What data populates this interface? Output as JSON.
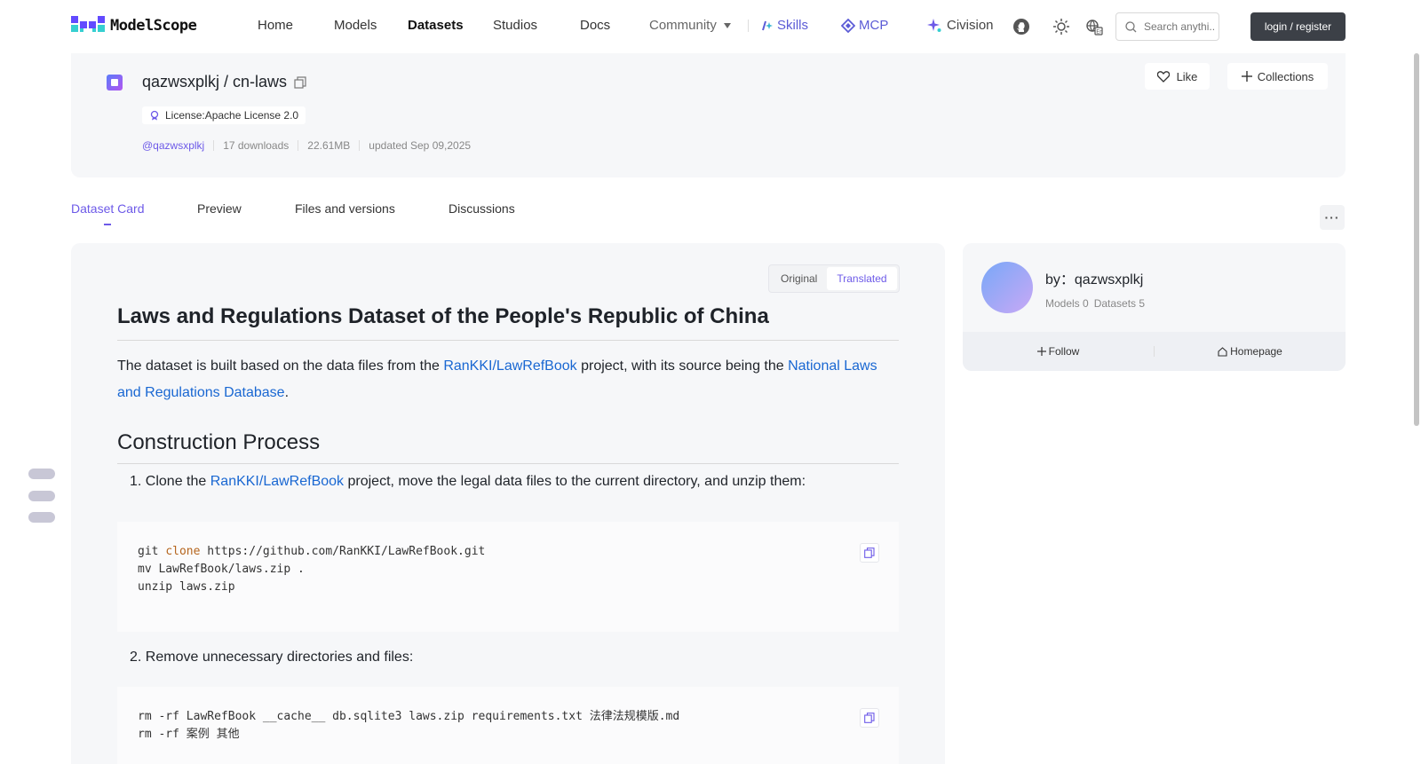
{
  "header": {
    "logo_text": "ModelScope",
    "nav": {
      "home": "Home",
      "models": "Models",
      "datasets": "Datasets",
      "studios": "Studios",
      "docs": "Docs",
      "community": "Community",
      "skills": "Skills",
      "mcp": "MCP",
      "civision": "Civision"
    },
    "search_placeholder": "Search anythi...",
    "login_label": "login / register",
    "icons": [
      "github-icon",
      "theme-sun-icon",
      "language-icon",
      "search-icon"
    ]
  },
  "dataset": {
    "title": "qazwsxplkj / cn-laws",
    "license": "License:Apache License 2.0",
    "owner": "@qazwsxplkj",
    "downloads": "17 downloads",
    "size": "22.61MB",
    "updated": "updated Sep 09,2025",
    "like_label": "Like",
    "collections_label": "Collections"
  },
  "tabs": {
    "card": "Dataset Card",
    "preview": "Preview",
    "files": "Files and versions",
    "discussions": "Discussions",
    "active": "Dataset Card"
  },
  "content": {
    "toggle_original": "Original",
    "toggle_translated": "Translated",
    "toggle_selected": "Translated",
    "heading": "Laws and Regulations Dataset of the People's Republic of China",
    "intro": {
      "t1": "The dataset is built based on the data files from the ",
      "link1": "RanKKI/LawRefBook",
      "t2": " project, with its source being the ",
      "link2": "National Laws and Regulations Database",
      "t3": "."
    },
    "section_heading": "Construction Process",
    "step1": {
      "num": "1.",
      "t1": "Clone the ",
      "link": "RanKKI/LawRefBook",
      "t2": " project, move the legal data files to the current directory, and unzip them:"
    },
    "code1": {
      "l1_a": "git ",
      "l1_kw": "clone",
      "l1_b": " https://github.com/RanKKI/LawRefBook.git",
      "l2": "mv LawRefBook/laws.zip .",
      "l3": "unzip laws.zip"
    },
    "step2": {
      "num": "2.",
      "text": "Remove unnecessary directories and files:"
    },
    "code2": {
      "l1": "rm -rf LawRefBook __cache__ db.sqlite3 laws.zip requirements.txt 法律法规模版.md",
      "l2": "rm -rf 案例 其他"
    }
  },
  "author": {
    "by_label": "by：qazwsxplkj",
    "models": "Models 0",
    "datasets": "Datasets 5",
    "follow_label": "Follow",
    "homepage_label": "Homepage"
  },
  "colors": {
    "accent": "#6d5ae8",
    "link": "#1967d2",
    "panel_bg": "#f6f7f9",
    "login_bg": "#3c4047"
  }
}
